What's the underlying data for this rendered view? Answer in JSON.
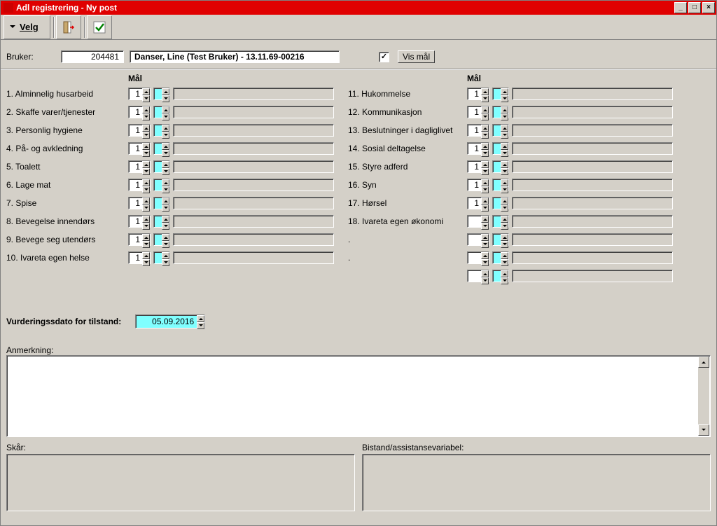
{
  "window": {
    "title": "Adl registrering - Ny post"
  },
  "toolbar": {
    "velg_label": "Velg"
  },
  "header": {
    "bruker_label": "Bruker:",
    "bruker_id": "204481",
    "bruker_name": "Danser, Line (Test Bruker) - 13.11.69-00216",
    "vis_maal_label": "Vis mål",
    "vis_maal_checked": true
  },
  "maal_header": "Mål",
  "left_items": [
    {
      "label": "1. Alminnelig husarbeid",
      "value": "1"
    },
    {
      "label": "2. Skaffe varer/tjenester",
      "value": "1"
    },
    {
      "label": "3. Personlig hygiene",
      "value": "1"
    },
    {
      "label": "4. På- og avkledning",
      "value": "1"
    },
    {
      "label": "5. Toalett",
      "value": "1"
    },
    {
      "label": "6. Lage mat",
      "value": "1"
    },
    {
      "label": "7. Spise",
      "value": "1"
    },
    {
      "label": "8. Bevegelse innendørs",
      "value": "1"
    },
    {
      "label": "9. Bevege seg utendørs",
      "value": "1"
    },
    {
      "label": "10. Ivareta egen helse",
      "value": "1"
    }
  ],
  "right_items": [
    {
      "label": "11. Hukommelse",
      "value": "1"
    },
    {
      "label": "12. Kommunikasjon",
      "value": "1"
    },
    {
      "label": "13. Beslutninger i dagliglivet",
      "value": "1"
    },
    {
      "label": "14. Sosial deltagelse",
      "value": "1"
    },
    {
      "label": "15. Styre adferd",
      "value": "1"
    },
    {
      "label": "16. Syn",
      "value": "1"
    },
    {
      "label": "17. Hørsel",
      "value": "1"
    },
    {
      "label": "18. Ivareta egen økonomi",
      "value": ""
    },
    {
      "label": ".",
      "value": ""
    },
    {
      "label": ".",
      "value": ""
    },
    {
      "label": "",
      "value": ""
    }
  ],
  "vurderingsdato": {
    "label": "Vurderingssdato for tilstand:",
    "value": "05.09.2016"
  },
  "anmerkning_label": "Anmerkning:",
  "skaar_label": "Skår:",
  "bistand_label": "Bistand/assistansevariabel:"
}
